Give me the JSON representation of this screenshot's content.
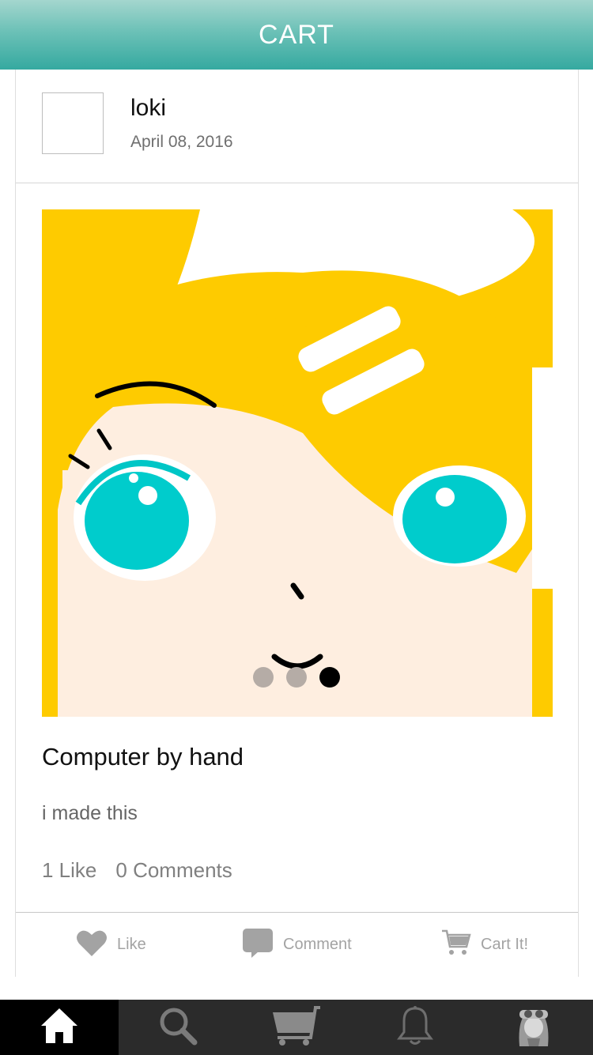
{
  "header": {
    "title": "CART"
  },
  "post": {
    "author": "loki",
    "date": "April 08, 2016",
    "title": "Computer by hand",
    "description": "i made this",
    "likes_text": "1 Like",
    "comments_text": "0 Comments",
    "carousel": {
      "count": 3,
      "active_index": 2
    }
  },
  "actions": {
    "like_label": "Like",
    "comment_label": "Comment",
    "cart_label": "Cart It!"
  },
  "tabbar": {
    "items": [
      {
        "icon": "home-icon",
        "active": true
      },
      {
        "icon": "search-icon",
        "active": false
      },
      {
        "icon": "cart-icon",
        "active": false
      },
      {
        "icon": "bell-icon",
        "active": false
      },
      {
        "icon": "profile-avatar-icon",
        "active": false
      }
    ]
  },
  "colors": {
    "header_gradient_top": "#a4d6ce",
    "header_gradient_bottom": "#35a9a0",
    "tabbar_bg": "#2b2b2b",
    "active_tab_bg": "#000000",
    "action_gray": "#a3a3a3"
  }
}
